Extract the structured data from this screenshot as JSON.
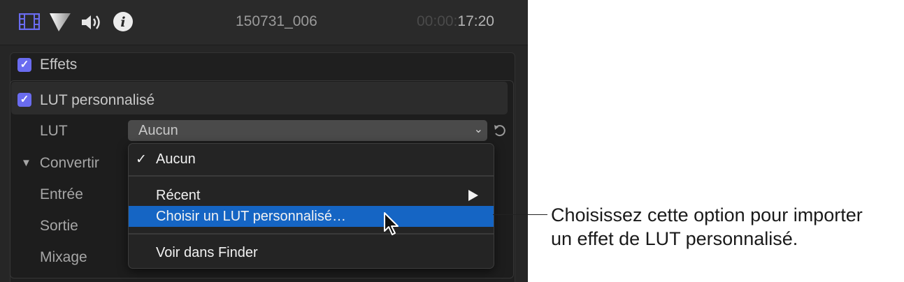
{
  "header": {
    "clip_name": "150731_006",
    "timecode_dim": "00:00:",
    "timecode_bright": "17:20",
    "icons": [
      "video-inspector-icon",
      "color-inspector-icon",
      "audio-inspector-icon",
      "info-inspector-icon"
    ]
  },
  "effects": {
    "label": "Effets",
    "checked": true
  },
  "lut_effect": {
    "title": "LUT personnalisé",
    "checked": true,
    "lut_label": "LUT",
    "lut_value": "Aucun",
    "convert_label": "Convertir",
    "input_label": "Entrée",
    "output_label": "Sortie",
    "mix_label": "Mixage"
  },
  "menu": {
    "items": [
      {
        "label": "Aucun",
        "checked": true
      },
      {
        "label": "Récent",
        "submenu": true
      },
      {
        "label": "Choisir un LUT personnalisé…",
        "selected": true
      },
      {
        "label": "Voir dans Finder"
      }
    ]
  },
  "callout": {
    "line1": "Choisissez cette option pour importer",
    "line2": "un effet de LUT personnalisé."
  },
  "colors": {
    "accent": "#6a6cf0",
    "menu_selection": "#1565c4"
  }
}
